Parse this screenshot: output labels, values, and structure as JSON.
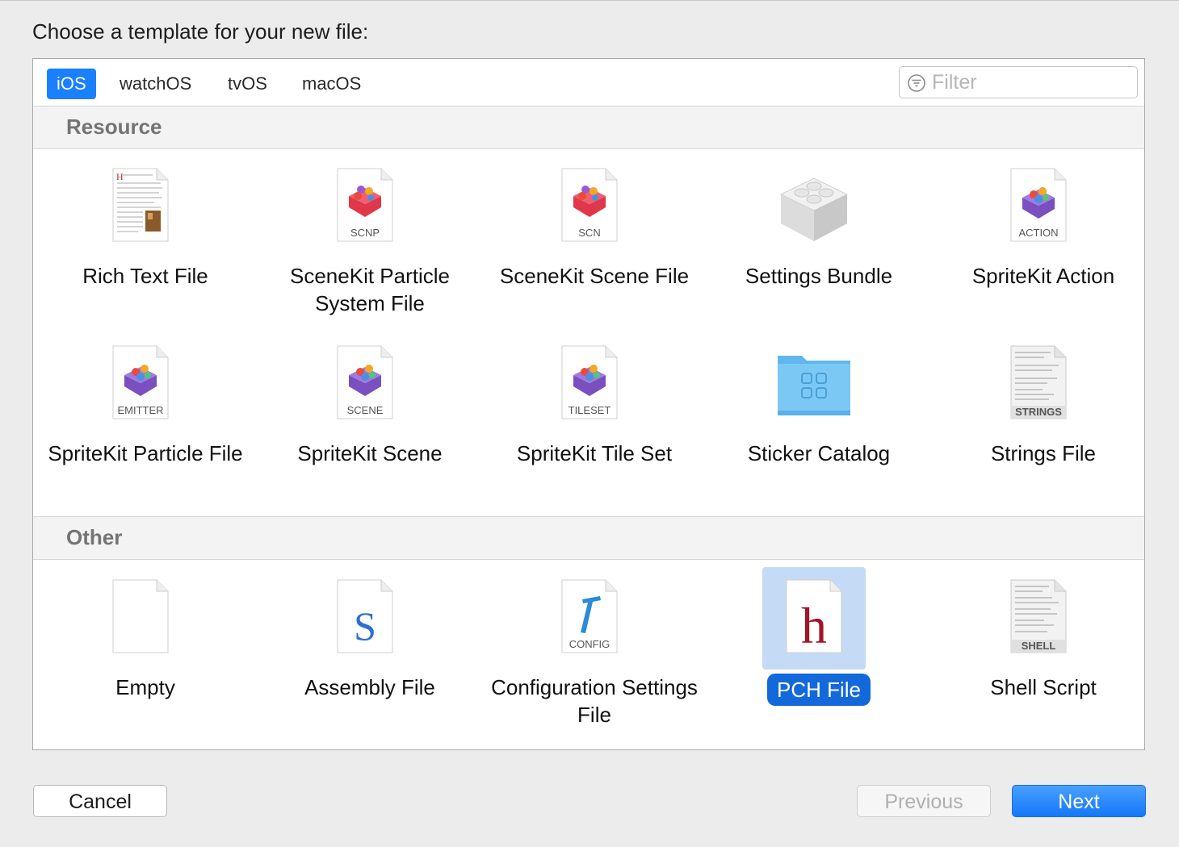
{
  "dialog": {
    "heading": "Choose a template for your new file:"
  },
  "platform_tabs": [
    {
      "label": "iOS",
      "selected": true
    },
    {
      "label": "watchOS",
      "selected": false
    },
    {
      "label": "tvOS",
      "selected": false
    },
    {
      "label": "macOS",
      "selected": false
    }
  ],
  "filter": {
    "placeholder": "Filter",
    "icon": "filter-icon"
  },
  "sections": [
    {
      "title": "Resource",
      "items": [
        {
          "label": "Rich Text File",
          "icon": "rich-text-document-icon"
        },
        {
          "label": "SceneKit Particle System File",
          "icon": "scenekit-particle-icon",
          "badge": "SCNP"
        },
        {
          "label": "SceneKit Scene File",
          "icon": "scenekit-scene-icon",
          "badge": "SCN"
        },
        {
          "label": "Settings Bundle",
          "icon": "lego-brick-icon"
        },
        {
          "label": "SpriteKit Action",
          "icon": "spritekit-action-icon",
          "badge": "ACTION"
        },
        {
          "label": "SpriteKit Particle File",
          "icon": "spritekit-emitter-icon",
          "badge": "EMITTER"
        },
        {
          "label": "SpriteKit Scene",
          "icon": "spritekit-scene-icon",
          "badge": "SCENE"
        },
        {
          "label": "SpriteKit Tile Set",
          "icon": "spritekit-tileset-icon",
          "badge": "TILESET"
        },
        {
          "label": "Sticker Catalog",
          "icon": "folder-icon"
        },
        {
          "label": "Strings File",
          "icon": "strings-document-icon",
          "badge": "STRINGS"
        }
      ]
    },
    {
      "title": "Other",
      "items": [
        {
          "label": "Empty",
          "icon": "blank-document-icon"
        },
        {
          "label": "Assembly File",
          "icon": "assembly-document-icon",
          "glyph": "S"
        },
        {
          "label": "Configuration Settings File",
          "icon": "config-document-icon",
          "badge": "CONFIG"
        },
        {
          "label": "PCH File",
          "icon": "header-document-icon",
          "glyph": "h",
          "selected": true
        },
        {
          "label": "Shell Script",
          "icon": "shell-document-icon",
          "badge": "SHELL"
        }
      ]
    }
  ],
  "buttons": {
    "cancel": "Cancel",
    "previous": "Previous",
    "next": "Next"
  },
  "colors": {
    "accent": "#1a80ff",
    "selection": "#1369d9",
    "selection_bg": "#c4daf5",
    "section_title": "#747474"
  }
}
